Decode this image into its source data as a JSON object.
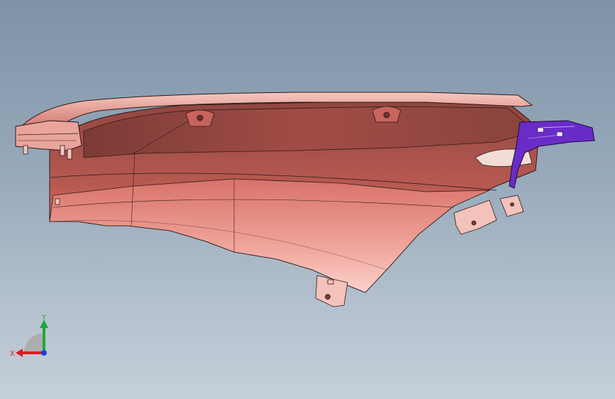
{
  "viewport": {
    "background_top": "#7f93a8",
    "background_bottom": "#c4cfd9"
  },
  "model": {
    "part_color": "#c96a62",
    "part_dark": "#7a3a36",
    "part_highlight": "#f3b8ae",
    "edge_color": "#2a1a18",
    "bracket_color": "#6a2cc7"
  },
  "triad": {
    "x_label": "X",
    "y_label": "Y",
    "x_color": "#d81e1e",
    "y_color": "#1fa83a",
    "z_color": "#1e3fd8"
  }
}
